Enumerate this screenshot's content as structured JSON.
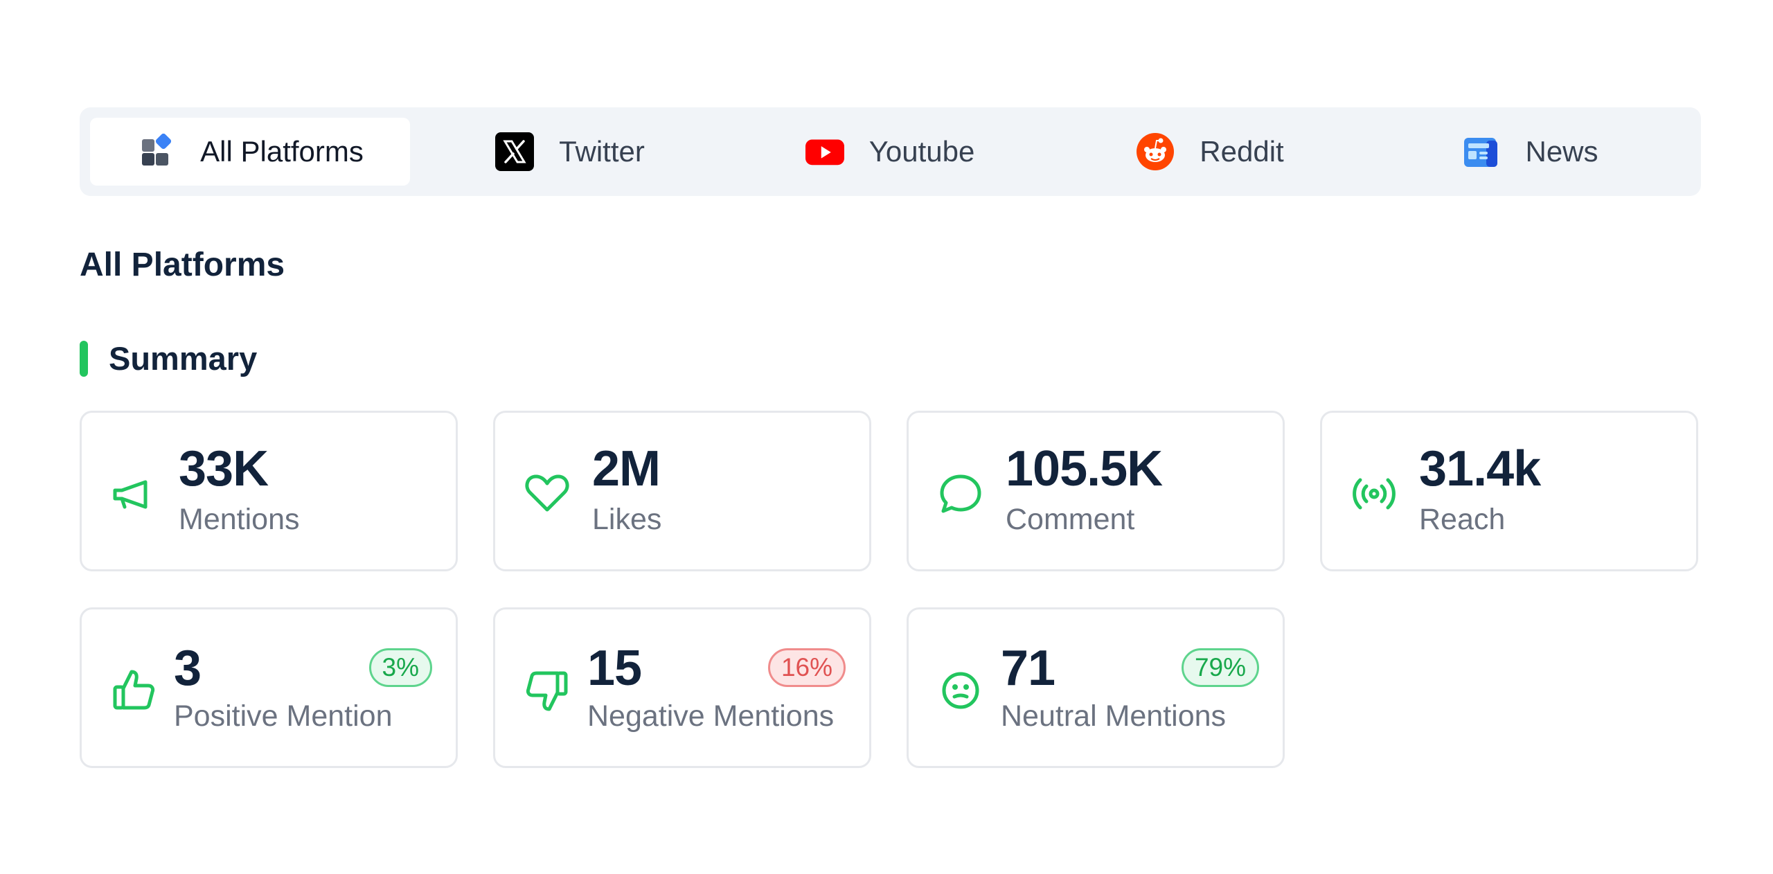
{
  "tabs": [
    {
      "label": "All Platforms",
      "icon": "all-platforms-icon",
      "active": true
    },
    {
      "label": "Twitter",
      "icon": "x-twitter-icon",
      "active": false
    },
    {
      "label": "Youtube",
      "icon": "youtube-icon",
      "active": false
    },
    {
      "label": "Reddit",
      "icon": "reddit-icon",
      "active": false
    },
    {
      "label": "News",
      "icon": "news-icon",
      "active": false
    }
  ],
  "page_title": "All Platforms",
  "section_title": "Summary",
  "accent_color": "#22c55e",
  "summary": {
    "mentions": {
      "value": "33K",
      "label": "Mentions",
      "icon": "megaphone-icon"
    },
    "likes": {
      "value": "2M",
      "label": "Likes",
      "icon": "heart-icon"
    },
    "comment": {
      "value": "105.5K",
      "label": "Comment",
      "icon": "comment-icon"
    },
    "reach": {
      "value": "31.4k",
      "label": "Reach",
      "icon": "broadcast-icon"
    }
  },
  "sentiment": {
    "positive": {
      "value": "3",
      "label": "Positive Mention",
      "badge": "3%",
      "badge_color": "#18a84b",
      "icon": "thumbs-up-icon"
    },
    "negative": {
      "value": "15",
      "label": "Negative Mentions",
      "badge": "16%",
      "badge_color": "#e05252",
      "icon": "thumbs-down-icon"
    },
    "neutral": {
      "value": "71",
      "label": "Neutral Mentions",
      "badge": "79%",
      "badge_color": "#18a84b",
      "icon": "neutral-face-icon"
    }
  }
}
